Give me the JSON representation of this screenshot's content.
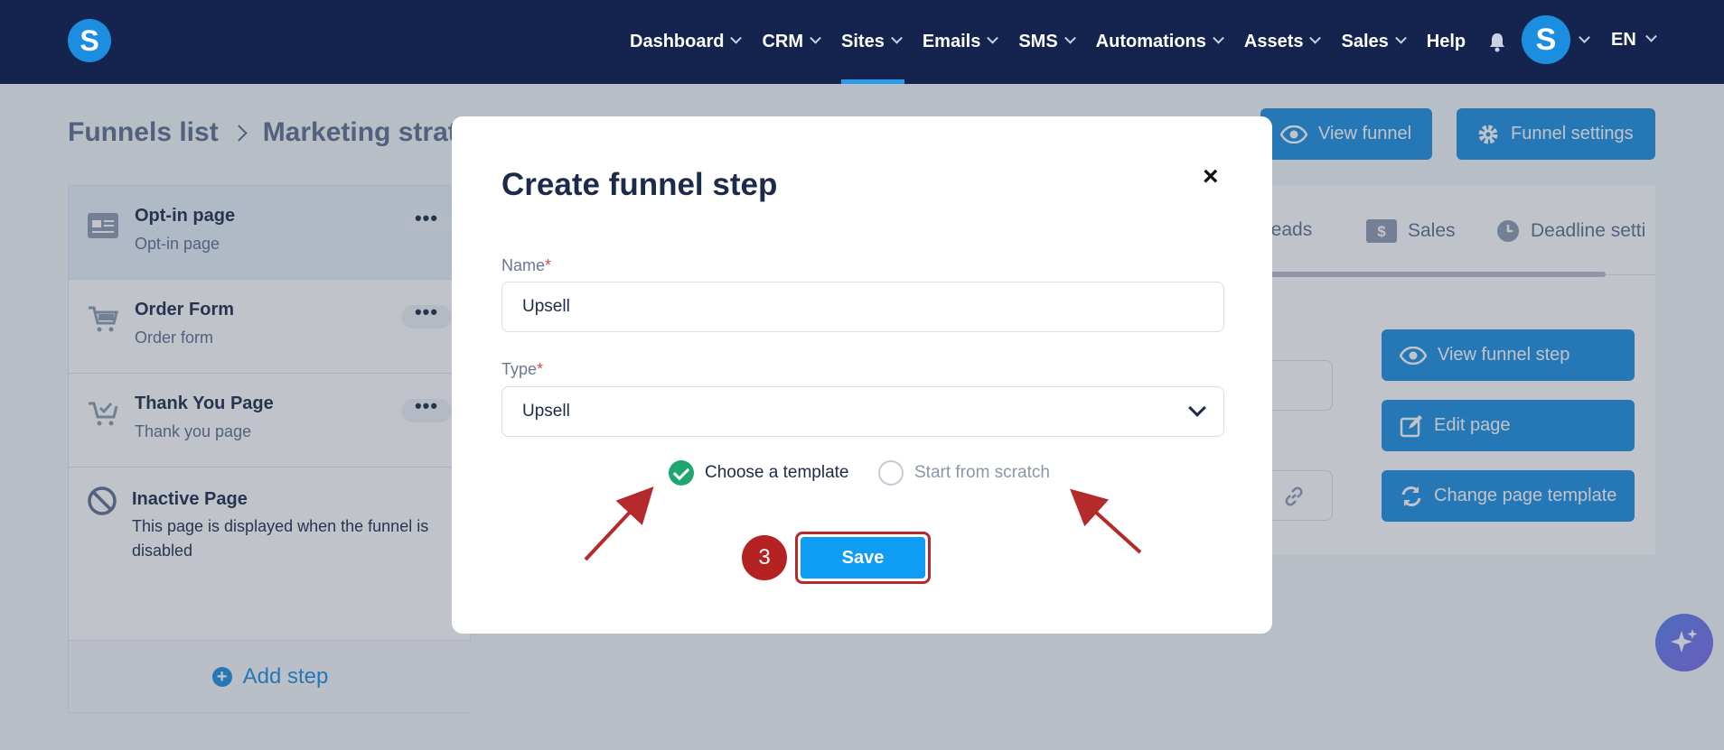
{
  "nav": {
    "logo": "S",
    "items": [
      {
        "label": "Dashboard",
        "active": false
      },
      {
        "label": "CRM",
        "active": false
      },
      {
        "label": "Sites",
        "active": true
      },
      {
        "label": "Emails",
        "active": false
      },
      {
        "label": "SMS",
        "active": false
      },
      {
        "label": "Automations",
        "active": false
      },
      {
        "label": "Assets",
        "active": false
      },
      {
        "label": "Sales",
        "active": false
      }
    ],
    "help": "Help",
    "avatar": "S",
    "lang": "EN"
  },
  "breadcrumb": {
    "root": "Funnels list",
    "current": "Marketing strat"
  },
  "header_buttons": {
    "view_funnel": "View funnel",
    "funnel_settings": "Funnel settings"
  },
  "steps": [
    {
      "title": "Opt-in page",
      "sub": "Opt-in page",
      "icon": "page-icon"
    },
    {
      "title": "Order Form",
      "sub": "Order form",
      "icon": "cart-icon"
    },
    {
      "title": "Thank You Page",
      "sub": "Thank you page",
      "icon": "cart-check-icon"
    }
  ],
  "inactive": {
    "title": "Inactive Page",
    "desc": "This page is displayed when the funnel is disabled"
  },
  "add_step": "Add step",
  "right_panel": {
    "tabs": {
      "leads": "Leads",
      "sales": "Sales",
      "deadline": "Deadline setti"
    },
    "view_step": "View funnel step",
    "edit_page": "Edit page",
    "change_template": "Change page template"
  },
  "modal": {
    "title": "Create funnel step",
    "name_label": "Name",
    "name_value": "Upsell",
    "type_label": "Type",
    "type_value": "Upsell",
    "required_mark": "*",
    "option_template": "Choose a template",
    "option_scratch": "Start from scratch",
    "selected_option": "Choose a template",
    "save": "Save",
    "close": "×"
  },
  "annotation": {
    "badge": "3"
  },
  "colors": {
    "nav_bg": "#14244f",
    "accent": "#1c8ee0",
    "highlight": "#b52a2a",
    "success": "#20a670"
  }
}
